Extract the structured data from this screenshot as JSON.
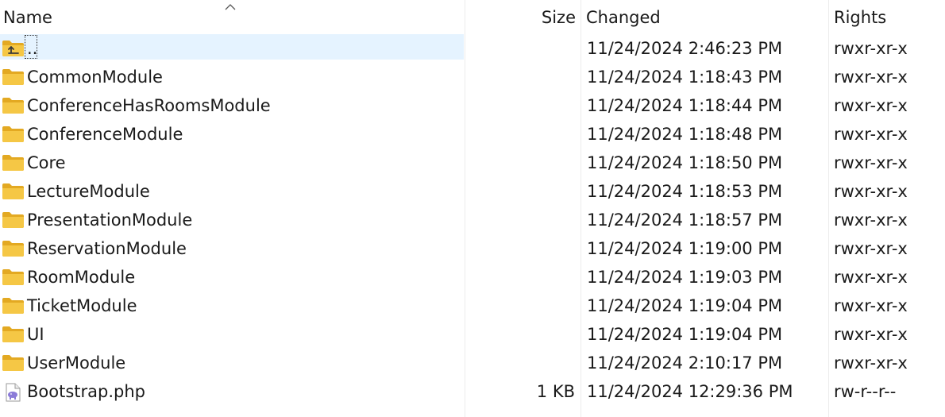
{
  "columns": {
    "name": "Name",
    "size": "Size",
    "changed": "Changed",
    "rights": "Rights"
  },
  "sort": {
    "column": "name",
    "direction": "ascending",
    "icon": "sort-ascending-icon"
  },
  "colors": {
    "selection": "#e5f3ff",
    "folder": "#f5c745",
    "folder_dark": "#e3a922",
    "php_purple": "#8b7bd8"
  },
  "files": [
    {
      "name": "..",
      "size": "",
      "changed": "11/24/2024 2:46:23 PM",
      "rights": "rwxr-xr-x",
      "type": "parent",
      "icon": "parent-folder-icon",
      "selected": true
    },
    {
      "name": "CommonModule",
      "size": "",
      "changed": "11/24/2024 1:18:43 PM",
      "rights": "rwxr-xr-x",
      "type": "folder",
      "icon": "folder-icon"
    },
    {
      "name": "ConferenceHasRoomsModule",
      "size": "",
      "changed": "11/24/2024 1:18:44 PM",
      "rights": "rwxr-xr-x",
      "type": "folder",
      "icon": "folder-icon"
    },
    {
      "name": "ConferenceModule",
      "size": "",
      "changed": "11/24/2024 1:18:48 PM",
      "rights": "rwxr-xr-x",
      "type": "folder",
      "icon": "folder-icon"
    },
    {
      "name": "Core",
      "size": "",
      "changed": "11/24/2024 1:18:50 PM",
      "rights": "rwxr-xr-x",
      "type": "folder",
      "icon": "folder-icon"
    },
    {
      "name": "LectureModule",
      "size": "",
      "changed": "11/24/2024 1:18:53 PM",
      "rights": "rwxr-xr-x",
      "type": "folder",
      "icon": "folder-icon"
    },
    {
      "name": "PresentationModule",
      "size": "",
      "changed": "11/24/2024 1:18:57 PM",
      "rights": "rwxr-xr-x",
      "type": "folder",
      "icon": "folder-icon"
    },
    {
      "name": "ReservationModule",
      "size": "",
      "changed": "11/24/2024 1:19:00 PM",
      "rights": "rwxr-xr-x",
      "type": "folder",
      "icon": "folder-icon"
    },
    {
      "name": "RoomModule",
      "size": "",
      "changed": "11/24/2024 1:19:03 PM",
      "rights": "rwxr-xr-x",
      "type": "folder",
      "icon": "folder-icon"
    },
    {
      "name": "TicketModule",
      "size": "",
      "changed": "11/24/2024 1:19:04 PM",
      "rights": "rwxr-xr-x",
      "type": "folder",
      "icon": "folder-icon"
    },
    {
      "name": "UI",
      "size": "",
      "changed": "11/24/2024 1:19:04 PM",
      "rights": "rwxr-xr-x",
      "type": "folder",
      "icon": "folder-icon"
    },
    {
      "name": "UserModule",
      "size": "",
      "changed": "11/24/2024 2:10:17 PM",
      "rights": "rwxr-xr-x",
      "type": "folder",
      "icon": "folder-icon"
    },
    {
      "name": "Bootstrap.php",
      "size": "1 KB",
      "changed": "11/24/2024 12:29:36 PM",
      "rights": "rw-r--r--",
      "type": "php",
      "icon": "php-file-icon"
    }
  ]
}
